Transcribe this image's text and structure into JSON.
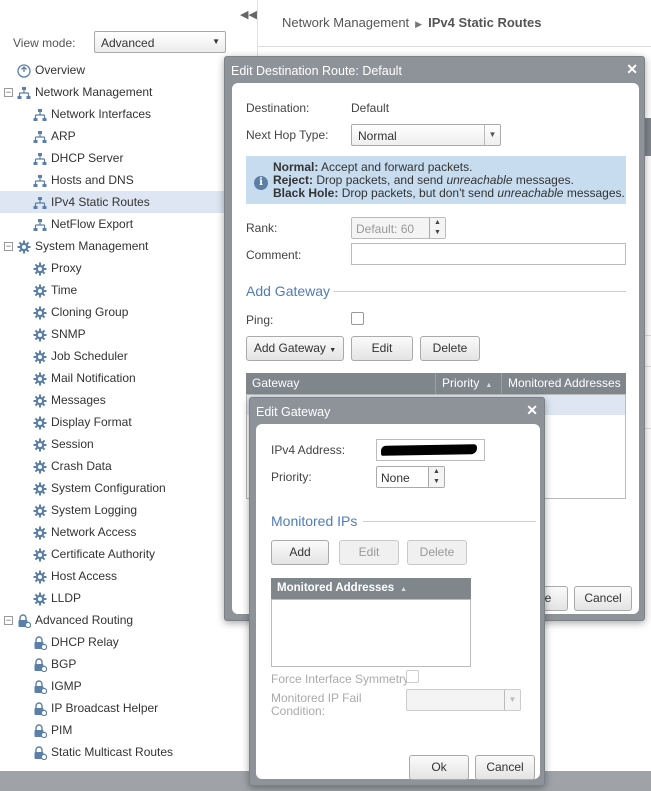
{
  "sidebar": {
    "view_mode_label": "View mode:",
    "view_mode_value": "Advanced",
    "nav": [
      {
        "label": "Overview",
        "level": 0,
        "icon": "overview-icon",
        "selected": false,
        "expander": ""
      },
      {
        "label": "Network Management",
        "level": 0,
        "icon": "network-icon",
        "selected": false,
        "expander": "−"
      },
      {
        "label": "Network Interfaces",
        "level": 1,
        "icon": "network-icon",
        "selected": false,
        "expander": ""
      },
      {
        "label": "ARP",
        "level": 1,
        "icon": "network-icon",
        "selected": false,
        "expander": ""
      },
      {
        "label": "DHCP Server",
        "level": 1,
        "icon": "network-icon",
        "selected": false,
        "expander": ""
      },
      {
        "label": "Hosts and DNS",
        "level": 1,
        "icon": "network-icon",
        "selected": false,
        "expander": ""
      },
      {
        "label": "IPv4 Static Routes",
        "level": 1,
        "icon": "network-icon",
        "selected": true,
        "expander": ""
      },
      {
        "label": "NetFlow Export",
        "level": 1,
        "icon": "network-icon",
        "selected": false,
        "expander": ""
      },
      {
        "label": "System Management",
        "level": 0,
        "icon": "gear-icon",
        "selected": false,
        "expander": "−"
      },
      {
        "label": "Proxy",
        "level": 1,
        "icon": "gear-icon",
        "selected": false,
        "expander": ""
      },
      {
        "label": "Time",
        "level": 1,
        "icon": "gear-icon",
        "selected": false,
        "expander": ""
      },
      {
        "label": "Cloning Group",
        "level": 1,
        "icon": "gear-icon",
        "selected": false,
        "expander": ""
      },
      {
        "label": "SNMP",
        "level": 1,
        "icon": "gear-icon",
        "selected": false,
        "expander": ""
      },
      {
        "label": "Job Scheduler",
        "level": 1,
        "icon": "gear-icon",
        "selected": false,
        "expander": ""
      },
      {
        "label": "Mail Notification",
        "level": 1,
        "icon": "gear-icon",
        "selected": false,
        "expander": ""
      },
      {
        "label": "Messages",
        "level": 1,
        "icon": "gear-icon",
        "selected": false,
        "expander": ""
      },
      {
        "label": "Display Format",
        "level": 1,
        "icon": "gear-icon",
        "selected": false,
        "expander": ""
      },
      {
        "label": "Session",
        "level": 1,
        "icon": "gear-icon",
        "selected": false,
        "expander": ""
      },
      {
        "label": "Crash Data",
        "level": 1,
        "icon": "gear-icon",
        "selected": false,
        "expander": ""
      },
      {
        "label": "System Configuration",
        "level": 1,
        "icon": "gear-icon",
        "selected": false,
        "expander": ""
      },
      {
        "label": "System Logging",
        "level": 1,
        "icon": "gear-icon",
        "selected": false,
        "expander": ""
      },
      {
        "label": "Network Access",
        "level": 1,
        "icon": "gear-icon",
        "selected": false,
        "expander": ""
      },
      {
        "label": "Certificate Authority",
        "level": 1,
        "icon": "gear-icon",
        "selected": false,
        "expander": ""
      },
      {
        "label": "Host Access",
        "level": 1,
        "icon": "gear-icon",
        "selected": false,
        "expander": ""
      },
      {
        "label": "LLDP",
        "level": 1,
        "icon": "gear-icon",
        "selected": false,
        "expander": ""
      },
      {
        "label": "Advanced Routing",
        "level": 0,
        "icon": "routing-lock-icon",
        "selected": false,
        "expander": "−"
      },
      {
        "label": "DHCP Relay",
        "level": 1,
        "icon": "routing-lock-icon",
        "selected": false,
        "expander": ""
      },
      {
        "label": "BGP",
        "level": 1,
        "icon": "routing-lock-icon",
        "selected": false,
        "expander": ""
      },
      {
        "label": "IGMP",
        "level": 1,
        "icon": "routing-lock-icon",
        "selected": false,
        "expander": ""
      },
      {
        "label": "IP Broadcast Helper",
        "level": 1,
        "icon": "routing-lock-icon",
        "selected": false,
        "expander": ""
      },
      {
        "label": "PIM",
        "level": 1,
        "icon": "routing-lock-icon",
        "selected": false,
        "expander": ""
      },
      {
        "label": "Static Multicast Routes",
        "level": 1,
        "icon": "routing-lock-icon",
        "selected": false,
        "expander": ""
      }
    ]
  },
  "breadcrumb": {
    "parent": "Network Management",
    "separator": "▶",
    "current": "IPv4 Static Routes"
  },
  "dialog1": {
    "title": "Edit Destination Route: Default",
    "close": "✕",
    "destination_label": "Destination:",
    "destination_value": "Default",
    "next_hop_label": "Next Hop Type:",
    "next_hop_value": "Normal",
    "info": {
      "normal_term": "Normal:",
      "normal_text": " Accept and forward packets.",
      "reject_term": "Reject:",
      "reject_text_a": " Drop packets, and send ",
      "reject_em": "unreachable",
      "reject_text_b": " messages.",
      "blackhole_term": "Black Hole:",
      "blackhole_text_a": " Drop packets, but don't send ",
      "blackhole_em": "unreachable",
      "blackhole_text_b": " messages."
    },
    "rank_label": "Rank:",
    "rank_placeholder": "Default: 60",
    "comment_label": "Comment:",
    "comment_value": "",
    "add_gateway_section": "Add Gateway",
    "ping_label": "Ping:",
    "ping_checked": false,
    "buttons": {
      "add_gateway": "Add Gateway",
      "edit": "Edit",
      "delete": "Delete",
      "save_partial": "e",
      "cancel": "Cancel"
    },
    "grid_columns": [
      "Gateway",
      "Priority",
      "Monitored Addresses"
    ]
  },
  "dialog2": {
    "title": "Edit Gateway",
    "close": "✕",
    "ipv4_label": "IPv4 Address:",
    "priority_label": "Priority:",
    "priority_value": "None",
    "monitored_ips_section": "Monitored IPs",
    "buttons": {
      "add": "Add",
      "edit": "Edit",
      "delete": "Delete",
      "ok": "Ok",
      "cancel": "Cancel"
    },
    "grid_column": "Monitored Addresses",
    "force_symmetry_label": "Force Interface Symmetry:",
    "force_symmetry_checked": false,
    "fail_condition_label_1": "Monitored IP Fail",
    "fail_condition_label_2": "Condition:",
    "fail_condition_value": ""
  },
  "colors": {
    "accent": "#4f7cb8",
    "selected_bg": "#dde6f2",
    "dialog_frame": "#8e9399",
    "info_bg": "#c7dcef",
    "grid_header": "#7f868c"
  }
}
